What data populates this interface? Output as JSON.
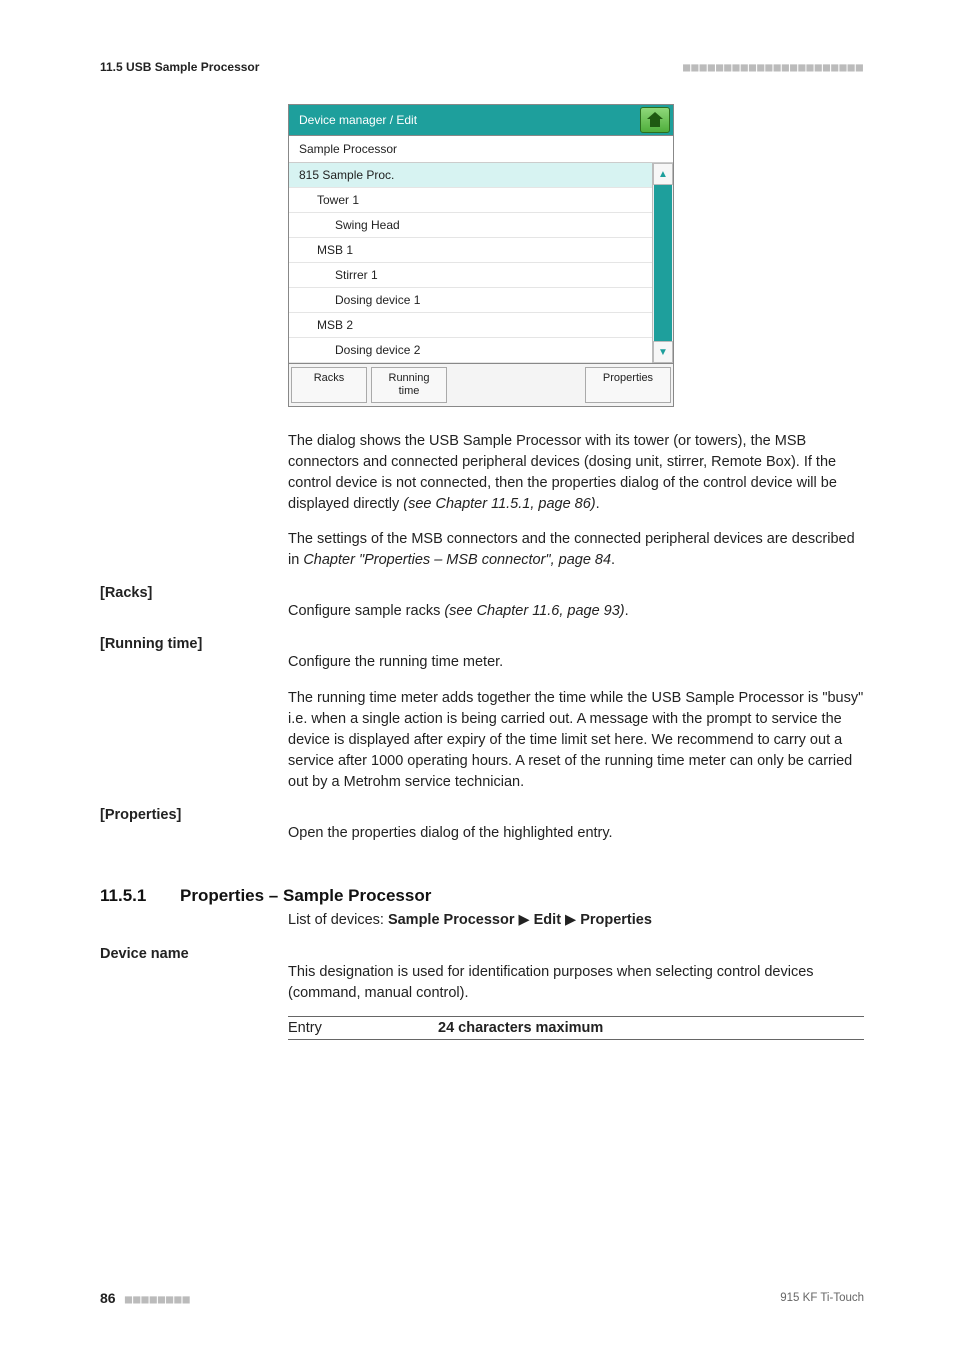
{
  "header": {
    "section_label": "11.5 USB Sample Processor",
    "dots": "■■■■■■■■■■■■■■■■■■■■■■"
  },
  "screenshot": {
    "title": "Device manager / Edit",
    "subhead": "Sample Processor",
    "rows": [
      {
        "label": "815 Sample Proc.",
        "indent": 0,
        "selected": true
      },
      {
        "label": "Tower 1",
        "indent": 1,
        "selected": false
      },
      {
        "label": "Swing Head",
        "indent": 2,
        "selected": false
      },
      {
        "label": "MSB 1",
        "indent": 1,
        "selected": false
      },
      {
        "label": "Stirrer 1",
        "indent": 2,
        "selected": false
      },
      {
        "label": "Dosing device 1",
        "indent": 2,
        "selected": false
      },
      {
        "label": "MSB 2",
        "indent": 1,
        "selected": false
      },
      {
        "label": "Dosing device 2",
        "indent": 2,
        "selected": false
      }
    ],
    "buttons": {
      "racks": "Racks",
      "running_time_l1": "Running",
      "running_time_l2": "time",
      "properties": "Properties"
    }
  },
  "paras": {
    "intro1a": "The dialog shows the USB Sample Processor with its tower (or towers), the MSB connectors and connected peripheral devices (dosing unit, stirrer, Remote Box). If the control device is not connected, then the properties dialog of the control device will be displayed directly ",
    "intro1b": "(see Chapter 11.5.1, page 86)",
    "intro1c": ".",
    "intro2a": "The settings of the MSB connectors and the connected peripheral devices are described in ",
    "intro2b": "Chapter \"Properties – MSB connector\", page 84",
    "intro2c": ".",
    "racks_a": "Configure sample racks ",
    "racks_b": "(see Chapter 11.6, page 93)",
    "racks_c": ".",
    "running_intro": "Configure the running time meter.",
    "running_body": "The running time meter adds together the time while the USB Sample Processor is \"busy\" i.e. when a single action is being carried out. A message with the prompt to service the device is displayed after expiry of the time limit set here. We recommend to carry out a service after 1000 operating hours. A reset of the running time meter can only be carried out by a Metrohm service technician.",
    "properties_body": "Open the properties dialog of the highlighted entry.",
    "devname_body": "This designation is used for identification purposes when selecting control devices (command, manual control)."
  },
  "labels": {
    "racks": "[Racks]",
    "running_time": "[Running time]",
    "properties": "[Properties]",
    "device_name": "Device name"
  },
  "section": {
    "num": "11.5.1",
    "title": "Properties – Sample Processor",
    "nav_prefix": "List of devices: ",
    "nav_b1": "Sample Processor",
    "nav_b2": "Edit",
    "nav_b3": "Properties"
  },
  "entry": {
    "key": "Entry",
    "value": "24 characters maximum"
  },
  "footer": {
    "page": "86",
    "dots": "■■■■■■■■",
    "product": "915 KF Ti-Touch"
  }
}
